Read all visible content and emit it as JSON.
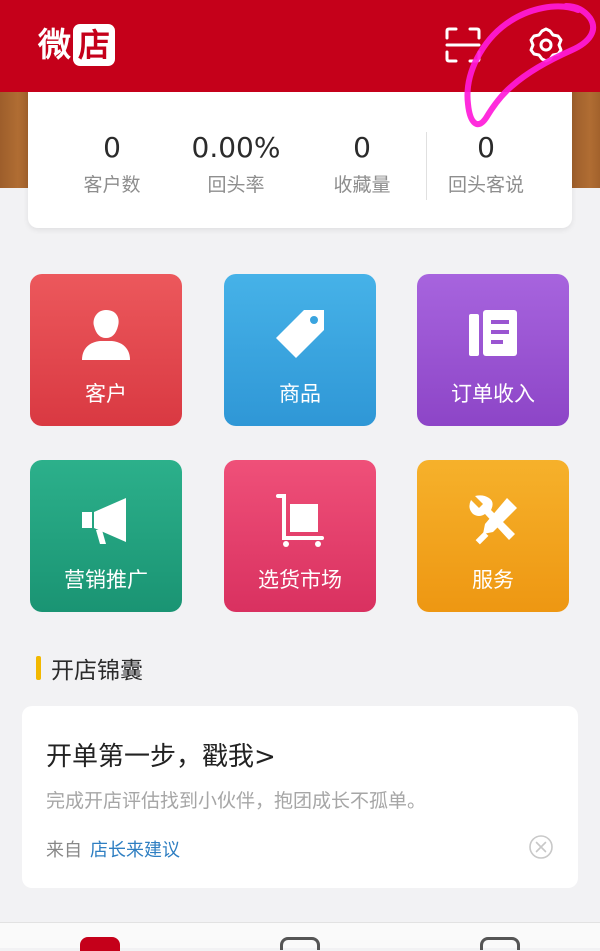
{
  "app": {
    "logo_char": "微",
    "logo_box_char": "店"
  },
  "header": {
    "icons": [
      "scan-icon",
      "gear-icon"
    ]
  },
  "stats": [
    {
      "value": "0",
      "label": "客户数"
    },
    {
      "value": "0.00%",
      "label": "回头率"
    },
    {
      "value": "0",
      "label": "收藏量"
    },
    {
      "value": "0",
      "label": "回头客说"
    }
  ],
  "tiles": [
    {
      "label": "客户",
      "icon": "person-icon",
      "color": "#e4434a"
    },
    {
      "label": "商品",
      "icon": "tag-icon",
      "color": "#3aa4df"
    },
    {
      "label": "订单收入",
      "icon": "document-icon",
      "color": "#9a55d1"
    },
    {
      "label": "营销推广",
      "icon": "megaphone-icon",
      "color": "#22a27f"
    },
    {
      "label": "选货市场",
      "icon": "cart-icon",
      "color": "#e63f6a"
    },
    {
      "label": "服务",
      "icon": "tools-icon",
      "color": "#f2a21b"
    }
  ],
  "tips": {
    "section_title": "开店锦囊",
    "card_title": "开单第一步，戳我>",
    "card_desc": "完成开店评估找到小伙伴，抱团成长不孤单。",
    "from_prefix": "来自",
    "from_link": "店长来建议"
  },
  "colors": {
    "header_bg": "#c5001a",
    "annotation": "#ff1ad9",
    "section_accent": "#f2b800",
    "link": "#2f7fc2"
  }
}
